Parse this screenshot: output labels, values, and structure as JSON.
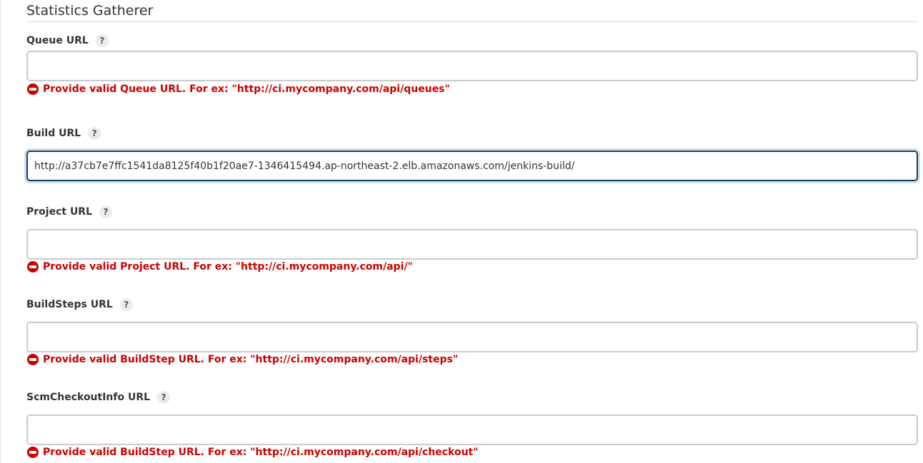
{
  "section": {
    "title": "Statistics Gatherer"
  },
  "fields": [
    {
      "label": "Queue URL",
      "help": "?",
      "value": "",
      "error": "Provide valid Queue URL. For ex: \"http://ci.mycompany.com/api/queues\""
    },
    {
      "label": "Build URL",
      "help": "?",
      "value": "http://a37cb7e7ffc1541da8125f40b1f20ae7-1346415494.ap-northeast-2.elb.amazonaws.com/jenkins-build/",
      "focused": true
    },
    {
      "label": "Project URL",
      "help": "?",
      "value": "",
      "error": "Provide valid Project URL. For ex: \"http://ci.mycompany.com/api/\""
    },
    {
      "label": "BuildSteps URL",
      "help": "?",
      "value": "",
      "error": "Provide valid BuildStep URL. For ex: \"http://ci.mycompany.com/api/steps\""
    },
    {
      "label": "ScmCheckoutInfo URL",
      "help": "?",
      "value": "",
      "error": "Provide valid BuildStep URL. For ex: \"http://ci.mycompany.com/api/checkout\""
    }
  ],
  "colors": {
    "error": "#cc0000",
    "focus_border": "#1b3d5c",
    "input_border": "#c9cbcd"
  },
  "icons": {
    "help": "question-mark-circle",
    "error": "no-entry-circle"
  }
}
